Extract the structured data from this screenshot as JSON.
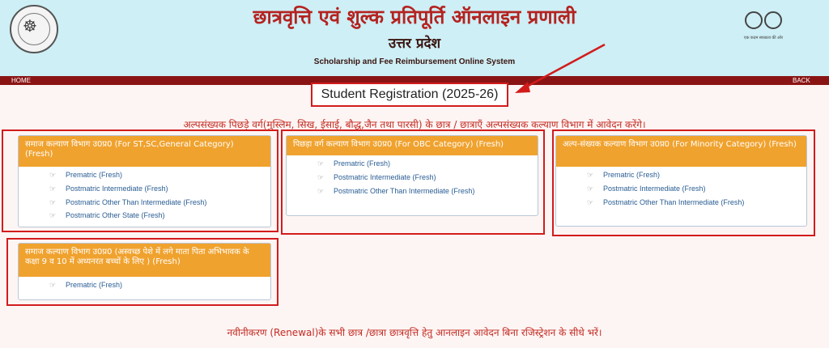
{
  "header": {
    "title_hindi": "छात्रवृत्ति एवं शुल्क प्रतिपूर्ति ऑनलाइन प्रणाली",
    "state_hindi": "उत्तर प्रदेश",
    "subtitle_english": "Scholarship and Fee Reimbursement Online System",
    "left_logo": "up-state-emblem-icon",
    "right_logo": "swachh-bharat-glasses-icon"
  },
  "nav": {
    "home": "HOME",
    "back": "BACK"
  },
  "registration_title": "Student Registration (2025-26)",
  "notice_minority": "अल्पसंख्यक पिछड़े वर्ग(मुस्लिम, सिख, ईसाई, बौद्ध,जैन तथा पारसी) के छात्र / छात्राएँ अल्पसंख्यक कल्याण विभाग में आवेदन करेंगे।",
  "panels": [
    {
      "heading": "समाज कल्याण विभाग उ0प्र0 (For ST,SC,General Category) (Fresh)",
      "links": [
        "Prematric (Fresh)",
        "Postmatric Intermediate (Fresh)",
        "Postmatric Other Than Intermediate (Fresh)",
        "Postmatric Other State (Fresh)"
      ]
    },
    {
      "heading": "पिछड़ा वर्ग कल्याण विभाग उ0प्र0 (For OBC Category) (Fresh)",
      "links": [
        "Prematric (Fresh)",
        "Postmatric Intermediate (Fresh)",
        "Postmatric Other Than Intermediate (Fresh)"
      ]
    },
    {
      "heading": "अल्प-संख्यक कल्याण विभाग उ0प्र0 (For Minority Category) (Fresh)",
      "links": [
        "Prematric (Fresh)",
        "Postmatric Intermediate (Fresh)",
        "Postmatric Other Than Intermediate (Fresh)"
      ]
    },
    {
      "heading": "समाज कल्याण विभाग उ0प्र0 (अस्वच्छ पेशे में लगे माता पिता अभिभावक के कक्षा 9 व 10 में अध्यनरत बच्चों के लिए ) (Fresh)",
      "links": [
        "Prematric (Fresh)"
      ]
    }
  ],
  "notice_renewal": "नवीनीकरण (Renewal)के सभी छात्र /छात्रा छात्रवृत्ति हेतु आनलाइन आवेदन बिना रजिस्ट्रेशन के सीधे भरें।",
  "colors": {
    "header_bg": "#cdeff5",
    "title_red": "#b5221f",
    "navbar": "#8a1414",
    "panel_heading": "#f0a22e",
    "link_blue": "#2a5d93",
    "highlight_red": "#d21c1c"
  }
}
